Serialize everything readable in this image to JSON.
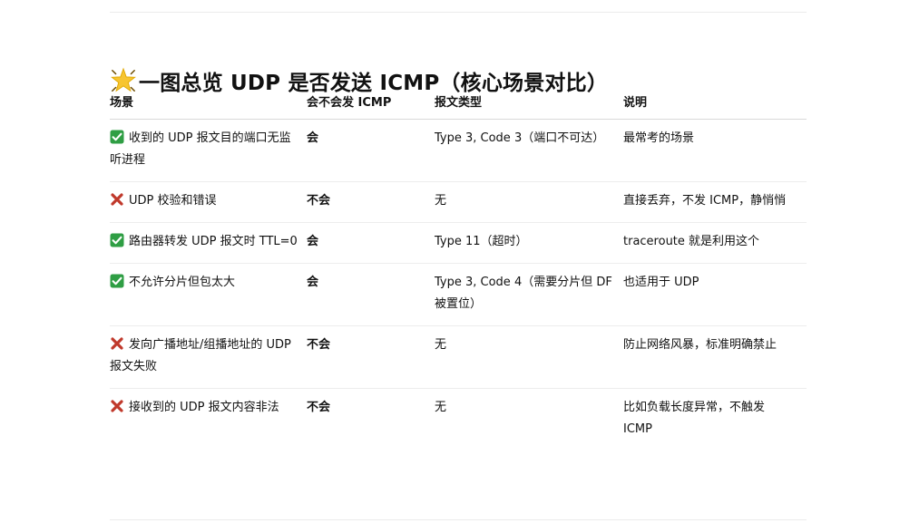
{
  "heading": {
    "icon": "sparkle-star-icon",
    "text": "一图总览 UDP 是否发送 ICMP（核心场景对比）"
  },
  "colors": {
    "check_green": "#2f9e44",
    "cross_red": "#c0392b",
    "star_yellow": "#f7c531"
  },
  "table": {
    "headers": [
      "场景",
      "会不会发 ICMP",
      "报文类型",
      "说明"
    ],
    "rows": [
      {
        "icon": "check-icon",
        "scenario": "收到的 UDP 报文目的端口无监听进程",
        "sends": "会",
        "type": "Type 3, Code 3（端口不可达）",
        "note": "最常考的场景"
      },
      {
        "icon": "cross-icon",
        "scenario": "UDP 校验和错误",
        "sends": "不会",
        "type": "无",
        "note": "直接丢弃，不发 ICMP，静悄悄"
      },
      {
        "icon": "check-icon",
        "scenario": "路由器转发 UDP 报文时 TTL=0",
        "sends": "会",
        "type": "Type 11（超时）",
        "note": "traceroute 就是利用这个"
      },
      {
        "icon": "check-icon",
        "scenario": "不允许分片但包太大",
        "sends": "会",
        "type": "Type 3, Code 4（需要分片但 DF 被置位）",
        "note": "也适用于 UDP"
      },
      {
        "icon": "cross-icon",
        "scenario": "发向广播地址/组播地址的 UDP 报文失败",
        "sends": "不会",
        "type": "无",
        "note": "防止网络风暴，标准明确禁止"
      },
      {
        "icon": "cross-icon",
        "scenario": "接收到的 UDP 报文内容非法",
        "sends": "不会",
        "type": "无",
        "note": "比如负载长度异常，不触发 ICMP"
      }
    ]
  }
}
